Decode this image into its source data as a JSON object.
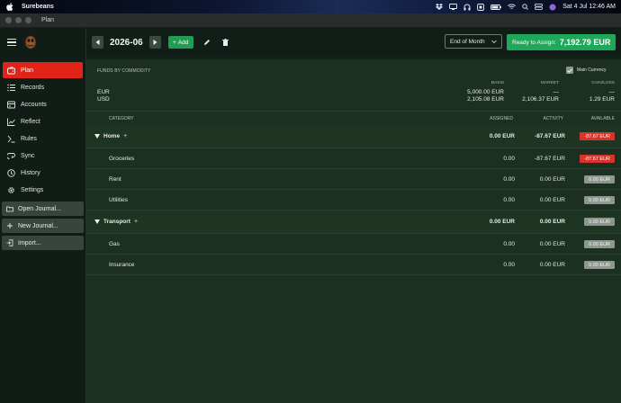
{
  "menubar": {
    "app_name": "Surebeans",
    "clock": "Sat 4 Jul  12:46 AM"
  },
  "window": {
    "title": "Plan"
  },
  "sidebar": {
    "nav": [
      {
        "label": "Plan",
        "icon": "wallet-icon",
        "active": true
      },
      {
        "label": "Records",
        "icon": "list-icon"
      },
      {
        "label": "Accounts",
        "icon": "accounts-icon"
      },
      {
        "label": "Reflect",
        "icon": "chart-icon"
      },
      {
        "label": "Rules",
        "icon": "rules-icon"
      },
      {
        "label": "Sync",
        "icon": "sync-icon"
      },
      {
        "label": "History",
        "icon": "history-icon"
      },
      {
        "label": "Settings",
        "icon": "gear-icon"
      }
    ],
    "actions": [
      {
        "label": "Open Journal...",
        "icon": "folder-icon"
      },
      {
        "label": "New Journal...",
        "icon": "plus-icon"
      },
      {
        "label": "Import...",
        "icon": "import-icon"
      }
    ]
  },
  "toolbar": {
    "month": "2026-06",
    "add_label": "Add",
    "period_select": "End of Month",
    "ready_label": "Ready to Assign:",
    "ready_amount": "7,192.79 EUR"
  },
  "funds": {
    "header": "FUNDS BY COMMODITY",
    "main_currency_label": "Main Currency",
    "main_currency_checked": true,
    "columns": {
      "basis": "BASIS",
      "market": "MARKET",
      "gainloss": "GAIN/LOSS"
    },
    "rows": [
      {
        "commodity": "EUR",
        "basis": "5,000.00 EUR",
        "market": "—",
        "gainloss": "—"
      },
      {
        "commodity": "USD",
        "basis": "2,105.08 EUR",
        "market": "2,106.37 EUR",
        "gainloss": "1.29 EUR"
      }
    ]
  },
  "table": {
    "columns": {
      "category": "CATEGORY",
      "assigned": "ASSIGNED",
      "activity": "ACTIVITY",
      "available": "AVAILABLE"
    },
    "groups": [
      {
        "name": "Home",
        "assigned": "0.00 EUR",
        "activity": "-87.67 EUR",
        "available": "-87.67 EUR",
        "available_status": "negative",
        "children": [
          {
            "name": "Groceries",
            "assigned": "0.00",
            "activity": "-87.67 EUR",
            "available": "-87.67 EUR",
            "available_status": "negative"
          },
          {
            "name": "Rent",
            "assigned": "0.00",
            "activity": "0.00 EUR",
            "available": "0.00 EUR",
            "available_status": "zero"
          },
          {
            "name": "Utilities",
            "assigned": "0.00",
            "activity": "0.00 EUR",
            "available": "0.00 EUR",
            "available_status": "zero"
          }
        ]
      },
      {
        "name": "Transport",
        "assigned": "0.00 EUR",
        "activity": "0.00 EUR",
        "available": "0.00 EUR",
        "available_status": "zero",
        "children": [
          {
            "name": "Gas",
            "assigned": "0.00",
            "activity": "0.00 EUR",
            "available": "0.00 EUR",
            "available_status": "zero"
          },
          {
            "name": "Insurance",
            "assigned": "0.00",
            "activity": "0.00 EUR",
            "available": "0.00 EUR",
            "available_status": "zero"
          }
        ]
      }
    ]
  },
  "colors": {
    "accent_red": "#e2231a",
    "accent_green": "#1fa859",
    "badge_negative": "#d9342b",
    "badge_zero": "#8e9690"
  }
}
